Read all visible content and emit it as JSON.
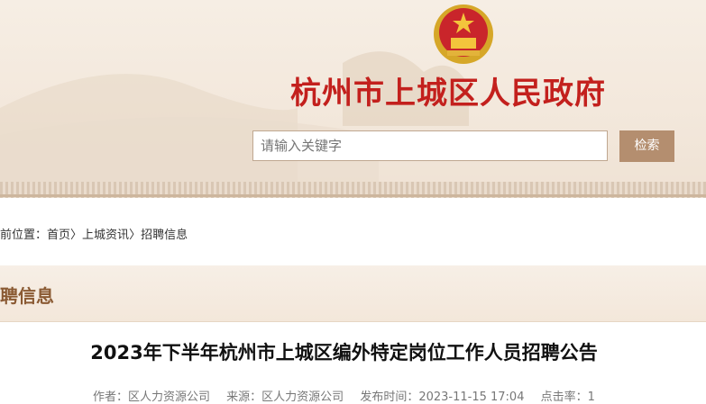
{
  "header": {
    "site_title": "杭州市上城区人民政府"
  },
  "search": {
    "placeholder": "请输入关键字",
    "button_label": "检索"
  },
  "breadcrumb": {
    "prefix": "前位置：",
    "items": [
      "首页",
      "上城资讯",
      "招聘信息"
    ],
    "separator": "〉"
  },
  "section": {
    "title": "聘信息"
  },
  "article": {
    "title": "2023年下半年杭州市上城区编外特定岗位工作人员招聘公告",
    "author": "作者：区人力资源公司",
    "source": "来源：区人力资源公司",
    "published": "发布时间：2023-11-15 17:04",
    "clicks": "点击率：1"
  },
  "colors": {
    "title_red": "#c3201d",
    "accent_brown": "#b48e6f",
    "section_brown": "#8a5a33"
  }
}
